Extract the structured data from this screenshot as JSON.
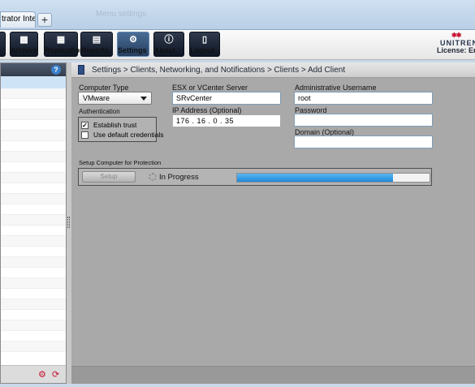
{
  "browser": {
    "tab_title": "trator Inter...",
    "newtab_symbol": "+",
    "ghost_title": "Menu settings"
  },
  "toolbar": {
    "buttons": [
      {
        "label": "",
        "icon": "pause-icon"
      },
      {
        "label": "Archive",
        "icon": "archive-icon"
      },
      {
        "label": "Replication",
        "icon": "replication-icon"
      },
      {
        "label": "Reports",
        "icon": "reports-icon"
      },
      {
        "label": "Settings",
        "icon": "gear-icon",
        "active": true
      },
      {
        "label": "About",
        "icon": "info-icon"
      },
      {
        "label": "Logout",
        "icon": "logout-icon"
      }
    ],
    "brand": "UNITREN",
    "license": "License: Ent"
  },
  "left_panel": {
    "help_symbol": "?"
  },
  "breadcrumb": "Settings > Clients, Networking, and Notifications > Clients > Add Client",
  "form": {
    "computer_type_label": "Computer Type",
    "computer_type_value": "VMware",
    "authentication_label": "Authentication",
    "establish_trust_label": "Establish trust",
    "establish_trust_checked": true,
    "use_default_label": "Use default credentials",
    "use_default_checked": false,
    "server_label": "ESX or VCenter Server",
    "server_value": "SRvCenter",
    "ip_label": "IP Address (Optional)",
    "ip_value": "176 . 16 . 0 . 35",
    "admin_label": "Administrative Username",
    "admin_value": "root",
    "password_label": "Password",
    "password_value": "",
    "domain_label": "Domain (Optional)",
    "domain_value": ""
  },
  "setup": {
    "section_label": "Setup Computer for Protection",
    "button_label": "Setup",
    "status": "In Progress",
    "progress_fraction": 0.81
  }
}
